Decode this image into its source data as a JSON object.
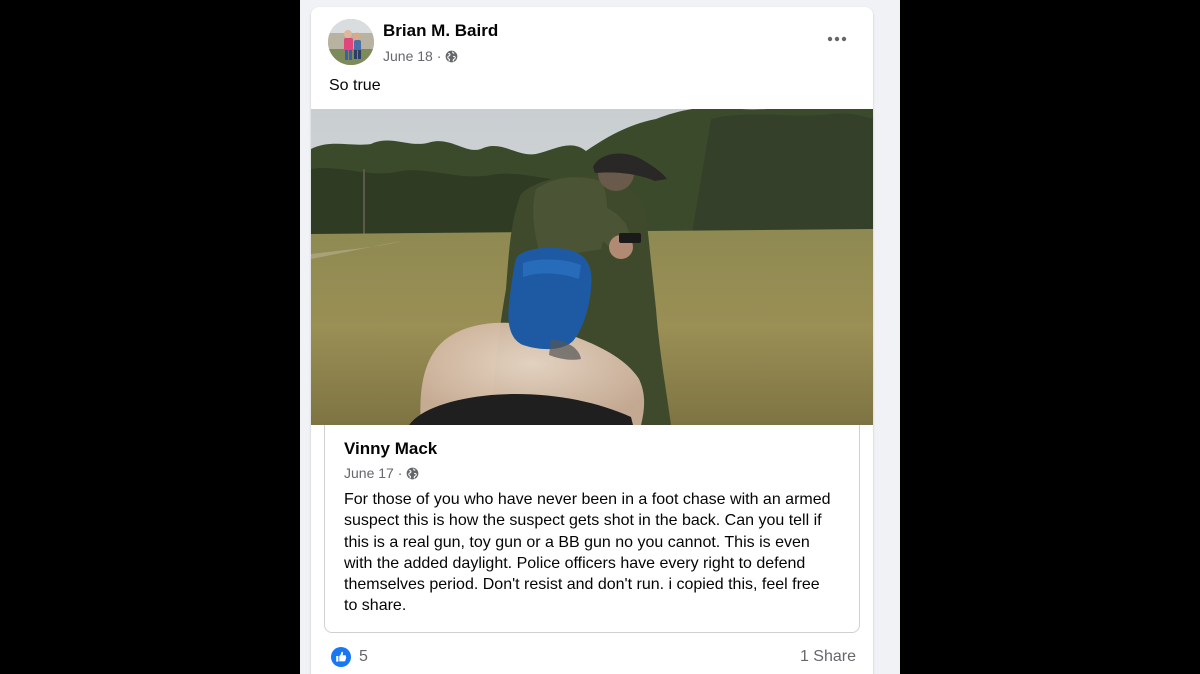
{
  "post": {
    "author": "Brian M. Baird",
    "date": "June 18 ·",
    "privacy_icon": "globe-icon",
    "text": "So true",
    "more_icon": "more-options-icon"
  },
  "shared_post": {
    "author": "Vinny Mack",
    "date": "June 17 ·",
    "privacy_icon": "globe-icon",
    "text": "For those of you who have never been in a foot chase with an armed suspect this is how the suspect gets shot in the back. Can you tell if this is a real gun, toy gun or a BB gun no you cannot. This is even with the added daylight. Police officers have every right to defend themselves period.  Don't resist and don't run.  i copied this, feel free to share."
  },
  "footer": {
    "reaction_icon": "like-icon",
    "reaction_count": "5",
    "share_count": "1 Share"
  },
  "colors": {
    "like_blue": "#1877f2",
    "text_primary": "#050505",
    "text_secondary": "#65676b",
    "feed_background": "#f0f2f5"
  }
}
